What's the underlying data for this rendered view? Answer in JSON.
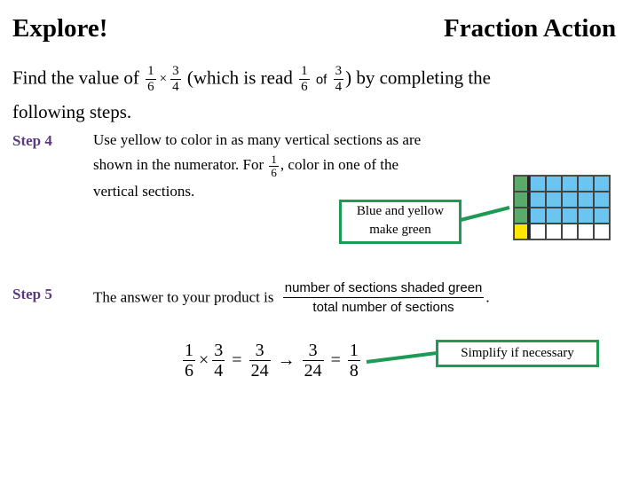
{
  "header": {
    "left_title": "Explore!",
    "right_title": "Fraction Action"
  },
  "intro": {
    "prefix": "Find the value of",
    "frac_a": {
      "num": "1",
      "den": "6"
    },
    "times": "×",
    "frac_b": {
      "num": "3",
      "den": "4"
    },
    "middle": "(which is read",
    "read_frac_a": {
      "num": "1",
      "den": "6"
    },
    "of": "of",
    "read_frac_b": {
      "num": "3",
      "den": "4"
    },
    "suffix": ") by completing the",
    "line2": "following steps."
  },
  "step4": {
    "label": "Step 4",
    "line1": "Use yellow to color in as many vertical sections as are",
    "line2_pre": "shown in the numerator.  For",
    "frac": {
      "num": "1",
      "den": "6"
    },
    "line2_post": ", color in one of the",
    "line3": "vertical sections."
  },
  "callout_green": {
    "line1": "Blue and yellow",
    "line2": "make green"
  },
  "grid": {
    "columns": 6,
    "rows": 4,
    "colors": {
      "green": "#5aab6a",
      "blue": "#6cc5f0",
      "yellow": "#ffe600",
      "white": "#ffffff"
    },
    "cells": [
      [
        "green",
        "blue",
        "blue",
        "blue",
        "blue",
        "blue"
      ],
      [
        "green",
        "blue",
        "blue",
        "blue",
        "blue",
        "blue"
      ],
      [
        "green",
        "blue",
        "blue",
        "blue",
        "blue",
        "blue"
      ],
      [
        "yellow",
        "white",
        "white",
        "white",
        "white",
        "white"
      ]
    ]
  },
  "step5": {
    "label": "Step 5",
    "text": "The answer to your product is",
    "frac_num": "number of sections shaded green",
    "frac_den": "total number of sections",
    "period": "."
  },
  "equation": {
    "a": {
      "num": "1",
      "den": "6"
    },
    "times": "×",
    "b": {
      "num": "3",
      "den": "4"
    },
    "eq1": "=",
    "c": {
      "num": "3",
      "den": "24"
    },
    "arrow": "→",
    "d": {
      "num": "3",
      "den": "24"
    },
    "eq2": "=",
    "e": {
      "num": "1",
      "den": "8"
    }
  },
  "callout_simplify": {
    "text": "Simplify if necessary"
  },
  "accent_color": "#1e9a55",
  "step_label_color": "#5b3a82"
}
